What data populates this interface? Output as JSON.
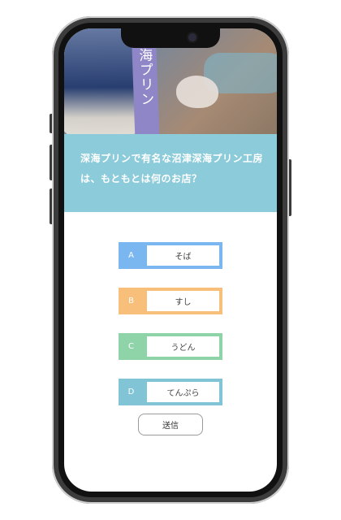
{
  "hero": {
    "alt_icon": "purin-photo",
    "stick_text": "深海プリン"
  },
  "question": {
    "text": "深海プリンで有名な沼津深海プリン工房は、もともとは何のお店？"
  },
  "options": [
    {
      "letter": "A",
      "label": "そば",
      "color": "#7ab6f0"
    },
    {
      "letter": "B",
      "label": "すし",
      "color": "#f7bf79"
    },
    {
      "letter": "C",
      "label": "うどん",
      "color": "#8fd4a9"
    },
    {
      "letter": "D",
      "label": "てんぷら",
      "color": "#80c4d6"
    }
  ],
  "submit": {
    "label": "送信"
  }
}
